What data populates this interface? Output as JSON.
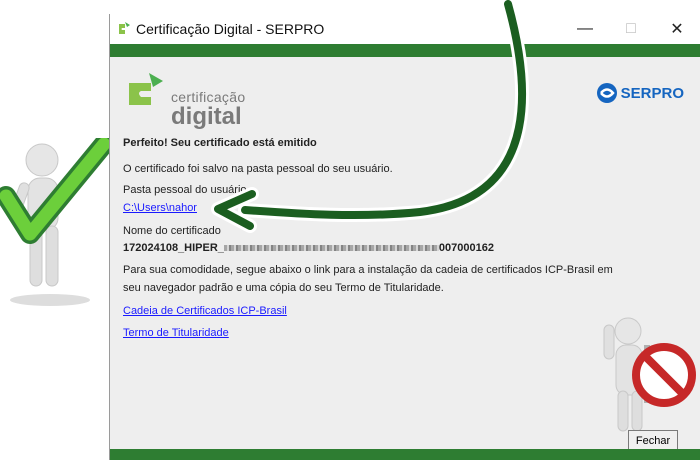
{
  "window": {
    "title": "Certificação Digital - SERPRO",
    "minimize": "—",
    "maximize": "□",
    "close": "✕"
  },
  "logo": {
    "small": "certificação",
    "big": "digital"
  },
  "brand": "SERPRO",
  "content": {
    "heading": "Perfeito! Seu certificado está emitido",
    "saved_msg": "O certificado foi salvo na pasta pessoal do seu usuário.",
    "folder_label": "Pasta pessoal do usuário",
    "folder_link": "C:\\Users\\nahor",
    "cert_name_label": "Nome do certificado",
    "cert_name_value": "172024108_HIPER_",
    "cert_name_suffix": "007000162",
    "info_line1": "Para sua comodidade, segue abaixo o link para a instalação da cadeia de certificados ICP-Brasil em",
    "info_line2": "seu navegador padrão e uma cópia do seu Termo de Titularidade.",
    "link_chain": "Cadeia de Certificados ICP-Brasil",
    "link_terms": "Termo de Titularidade",
    "close_button": "Fechar"
  },
  "colors": {
    "green_bar": "#2e7d32",
    "arrow": "#1b5e20",
    "link": "#1a1aff",
    "serpro_blue": "#1565c0"
  },
  "icons": [
    "app-logo-icon",
    "serpro-logo-icon",
    "check-figure",
    "stop-figure",
    "curved-arrow"
  ]
}
